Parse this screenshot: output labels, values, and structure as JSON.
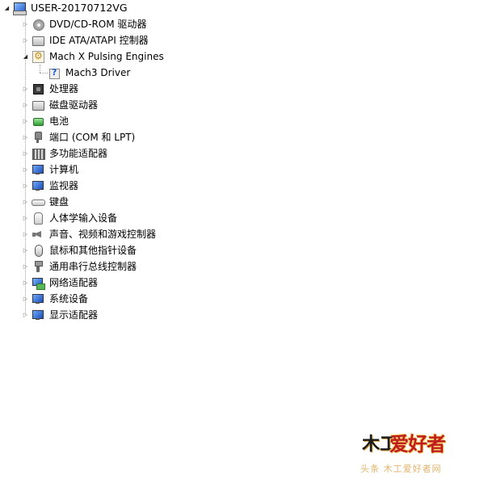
{
  "tree": {
    "root": {
      "label": "USER-20170712VG",
      "icon": "computer-icon",
      "expanded": true
    },
    "items": [
      {
        "label": "DVD/CD-ROM 驱动器",
        "icon": "disc-drive-icon",
        "expanded": false
      },
      {
        "label": "IDE ATA/ATAPI 控制器",
        "icon": "ide-controller-icon",
        "expanded": false
      },
      {
        "label": "Mach  X Pulsing Engines",
        "icon": "pulsing-engine-icon",
        "expanded": true,
        "children": [
          {
            "label": "Mach3 Driver",
            "icon": "unknown-device-icon"
          }
        ]
      },
      {
        "label": "处理器",
        "icon": "processor-icon",
        "expanded": false
      },
      {
        "label": "磁盘驱动器",
        "icon": "disk-drive-icon",
        "expanded": false
      },
      {
        "label": "电池",
        "icon": "battery-icon",
        "expanded": false
      },
      {
        "label": "端口 (COM 和 LPT)",
        "icon": "port-icon",
        "expanded": false
      },
      {
        "label": "多功能适配器",
        "icon": "multifunction-adapter-icon",
        "expanded": false
      },
      {
        "label": "计算机",
        "icon": "computer-icon",
        "expanded": false
      },
      {
        "label": "监视器",
        "icon": "monitor-icon",
        "expanded": false
      },
      {
        "label": "键盘",
        "icon": "keyboard-icon",
        "expanded": false
      },
      {
        "label": "人体学输入设备",
        "icon": "hid-icon",
        "expanded": false
      },
      {
        "label": "声音、视频和游戏控制器",
        "icon": "speaker-icon",
        "expanded": false
      },
      {
        "label": "鼠标和其他指针设备",
        "icon": "mouse-icon",
        "expanded": false
      },
      {
        "label": "通用串行总线控制器",
        "icon": "usb-icon",
        "expanded": false
      },
      {
        "label": "网络适配器",
        "icon": "network-adapter-icon",
        "expanded": false
      },
      {
        "label": "系统设备",
        "icon": "system-device-icon",
        "expanded": false
      },
      {
        "label": "显示适配器",
        "icon": "display-adapter-icon",
        "expanded": false
      }
    ]
  },
  "watermark": {
    "logo_a": "木工",
    "logo_b": "爱好者",
    "sub": "头条 木工爱好者网"
  },
  "colors": {
    "selection_bg": "#f0f6fc",
    "tree_line": "#a0a0a0",
    "watermark_red": "#c01e1e",
    "watermark_gold": "#e3b36c"
  }
}
